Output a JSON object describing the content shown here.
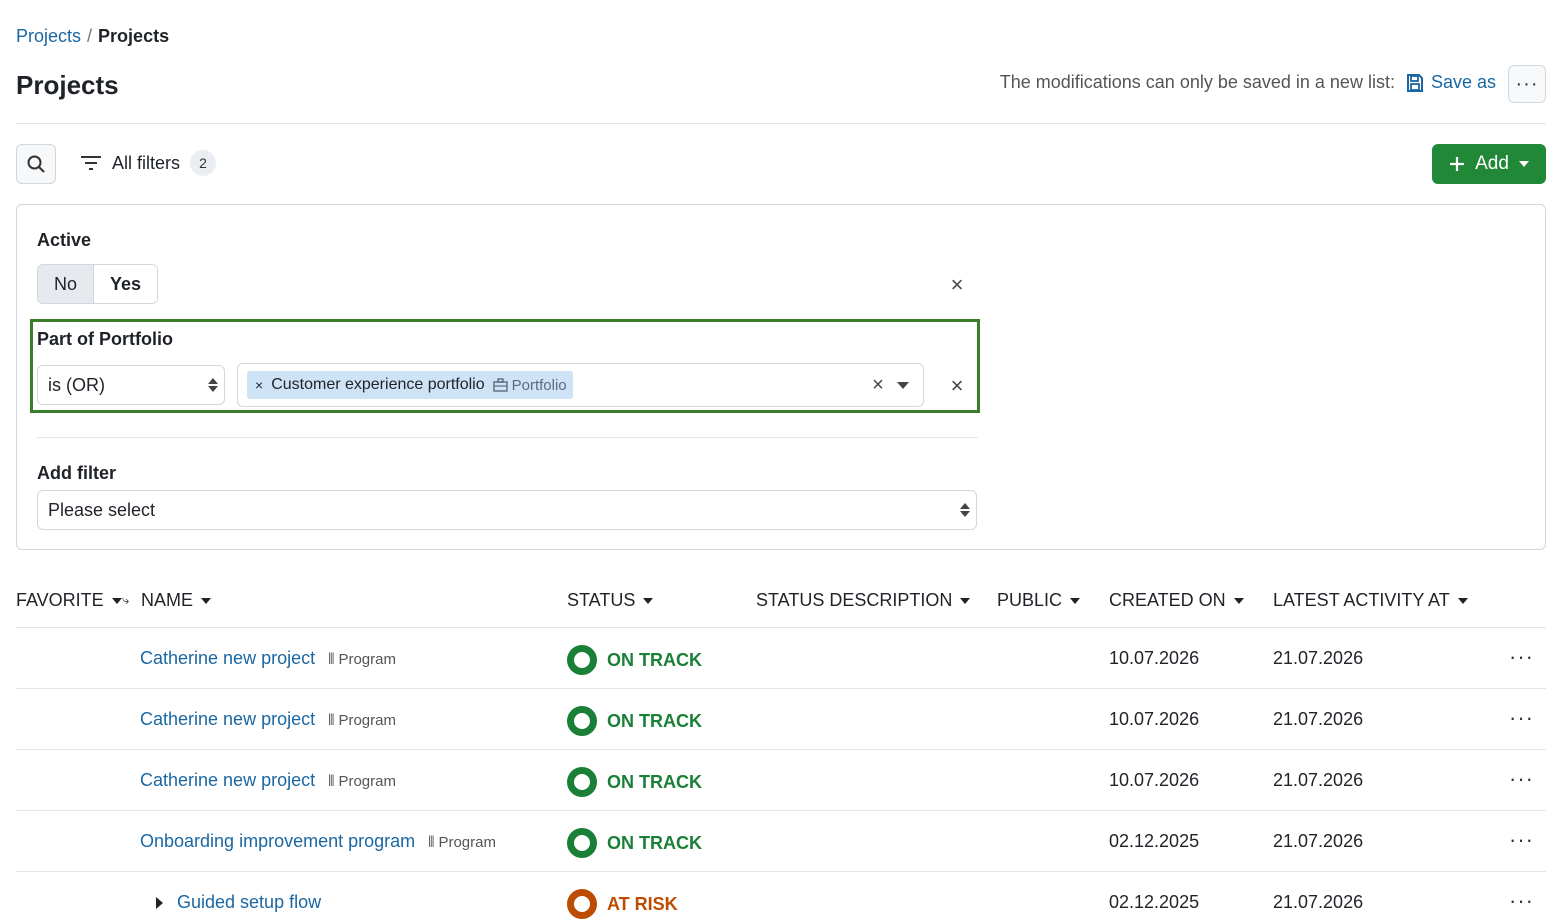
{
  "breadcrumb": {
    "parent": "Projects",
    "separator": "/",
    "current": "Projects"
  },
  "page": {
    "title": "Projects"
  },
  "header": {
    "save_message": "The modifications can only be saved in a new list:",
    "save_as_label": "Save as",
    "more_label": "···"
  },
  "toolbar": {
    "filters_label": "All filters",
    "filters_count": "2",
    "add_label": "Add"
  },
  "filters": {
    "active": {
      "label": "Active",
      "options": [
        "No",
        "Yes"
      ],
      "selected": "Yes",
      "remove": "×"
    },
    "portfolio": {
      "label": "Part of Portfolio",
      "operator": "is (OR)",
      "chip_label": "Customer experience portfolio",
      "chip_type": "Portfolio",
      "chip_remove": "×",
      "clear": "×",
      "remove": "×"
    },
    "add_filter": {
      "label": "Add filter",
      "placeholder": "Please select"
    }
  },
  "table": {
    "columns": [
      "FAVORITE",
      "NAME",
      "STATUS",
      "STATUS DESCRIPTION",
      "PUBLIC",
      "CREATED ON",
      "LATEST ACTIVITY AT"
    ],
    "rows": [
      {
        "name": "Catherine new project",
        "type": "Program",
        "status": "ON TRACK",
        "created": "10.07.2026",
        "latest": "21.07.2026"
      },
      {
        "name": "Catherine new project",
        "type": "Program",
        "status": "ON TRACK",
        "created": "10.07.2026",
        "latest": "21.07.2026"
      },
      {
        "name": "Catherine new project",
        "type": "Program",
        "status": "ON TRACK",
        "created": "10.07.2026",
        "latest": "21.07.2026"
      },
      {
        "name": "Onboarding improvement program",
        "type": "Program",
        "status": "ON TRACK",
        "created": "02.12.2025",
        "latest": "21.07.2026"
      },
      {
        "name": "Guided setup flow",
        "type": "",
        "status": "AT RISK",
        "created": "02.12.2025",
        "latest": "21.07.2026"
      }
    ]
  },
  "colors": {
    "on_track": "#1a7f37",
    "at_risk": "#bc4c00",
    "accent": "#1a67a3",
    "add_button": "#218838"
  }
}
